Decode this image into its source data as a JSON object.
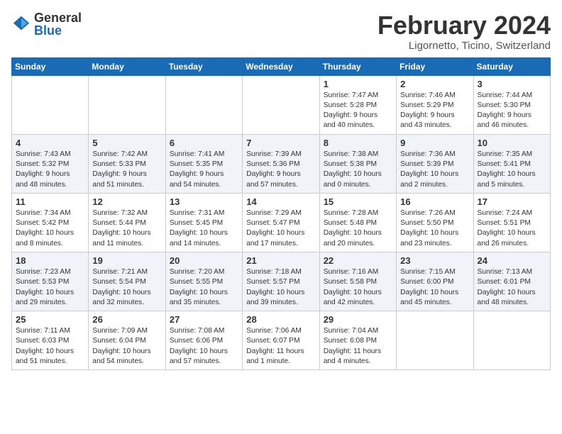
{
  "header": {
    "logo_general": "General",
    "logo_blue": "Blue",
    "month_year": "February 2024",
    "location": "Ligornetto, Ticino, Switzerland"
  },
  "weekdays": [
    "Sunday",
    "Monday",
    "Tuesday",
    "Wednesday",
    "Thursday",
    "Friday",
    "Saturday"
  ],
  "weeks": [
    [
      {
        "day": "",
        "info": ""
      },
      {
        "day": "",
        "info": ""
      },
      {
        "day": "",
        "info": ""
      },
      {
        "day": "",
        "info": ""
      },
      {
        "day": "1",
        "info": "Sunrise: 7:47 AM\nSunset: 5:28 PM\nDaylight: 9 hours\nand 40 minutes."
      },
      {
        "day": "2",
        "info": "Sunrise: 7:46 AM\nSunset: 5:29 PM\nDaylight: 9 hours\nand 43 minutes."
      },
      {
        "day": "3",
        "info": "Sunrise: 7:44 AM\nSunset: 5:30 PM\nDaylight: 9 hours\nand 46 minutes."
      }
    ],
    [
      {
        "day": "4",
        "info": "Sunrise: 7:43 AM\nSunset: 5:32 PM\nDaylight: 9 hours\nand 48 minutes."
      },
      {
        "day": "5",
        "info": "Sunrise: 7:42 AM\nSunset: 5:33 PM\nDaylight: 9 hours\nand 51 minutes."
      },
      {
        "day": "6",
        "info": "Sunrise: 7:41 AM\nSunset: 5:35 PM\nDaylight: 9 hours\nand 54 minutes."
      },
      {
        "day": "7",
        "info": "Sunrise: 7:39 AM\nSunset: 5:36 PM\nDaylight: 9 hours\nand 57 minutes."
      },
      {
        "day": "8",
        "info": "Sunrise: 7:38 AM\nSunset: 5:38 PM\nDaylight: 10 hours\nand 0 minutes."
      },
      {
        "day": "9",
        "info": "Sunrise: 7:36 AM\nSunset: 5:39 PM\nDaylight: 10 hours\nand 2 minutes."
      },
      {
        "day": "10",
        "info": "Sunrise: 7:35 AM\nSunset: 5:41 PM\nDaylight: 10 hours\nand 5 minutes."
      }
    ],
    [
      {
        "day": "11",
        "info": "Sunrise: 7:34 AM\nSunset: 5:42 PM\nDaylight: 10 hours\nand 8 minutes."
      },
      {
        "day": "12",
        "info": "Sunrise: 7:32 AM\nSunset: 5:44 PM\nDaylight: 10 hours\nand 11 minutes."
      },
      {
        "day": "13",
        "info": "Sunrise: 7:31 AM\nSunset: 5:45 PM\nDaylight: 10 hours\nand 14 minutes."
      },
      {
        "day": "14",
        "info": "Sunrise: 7:29 AM\nSunset: 5:47 PM\nDaylight: 10 hours\nand 17 minutes."
      },
      {
        "day": "15",
        "info": "Sunrise: 7:28 AM\nSunset: 5:48 PM\nDaylight: 10 hours\nand 20 minutes."
      },
      {
        "day": "16",
        "info": "Sunrise: 7:26 AM\nSunset: 5:50 PM\nDaylight: 10 hours\nand 23 minutes."
      },
      {
        "day": "17",
        "info": "Sunrise: 7:24 AM\nSunset: 5:51 PM\nDaylight: 10 hours\nand 26 minutes."
      }
    ],
    [
      {
        "day": "18",
        "info": "Sunrise: 7:23 AM\nSunset: 5:53 PM\nDaylight: 10 hours\nand 29 minutes."
      },
      {
        "day": "19",
        "info": "Sunrise: 7:21 AM\nSunset: 5:54 PM\nDaylight: 10 hours\nand 32 minutes."
      },
      {
        "day": "20",
        "info": "Sunrise: 7:20 AM\nSunset: 5:55 PM\nDaylight: 10 hours\nand 35 minutes."
      },
      {
        "day": "21",
        "info": "Sunrise: 7:18 AM\nSunset: 5:57 PM\nDaylight: 10 hours\nand 39 minutes."
      },
      {
        "day": "22",
        "info": "Sunrise: 7:16 AM\nSunset: 5:58 PM\nDaylight: 10 hours\nand 42 minutes."
      },
      {
        "day": "23",
        "info": "Sunrise: 7:15 AM\nSunset: 6:00 PM\nDaylight: 10 hours\nand 45 minutes."
      },
      {
        "day": "24",
        "info": "Sunrise: 7:13 AM\nSunset: 6:01 PM\nDaylight: 10 hours\nand 48 minutes."
      }
    ],
    [
      {
        "day": "25",
        "info": "Sunrise: 7:11 AM\nSunset: 6:03 PM\nDaylight: 10 hours\nand 51 minutes."
      },
      {
        "day": "26",
        "info": "Sunrise: 7:09 AM\nSunset: 6:04 PM\nDaylight: 10 hours\nand 54 minutes."
      },
      {
        "day": "27",
        "info": "Sunrise: 7:08 AM\nSunset: 6:06 PM\nDaylight: 10 hours\nand 57 minutes."
      },
      {
        "day": "28",
        "info": "Sunrise: 7:06 AM\nSunset: 6:07 PM\nDaylight: 11 hours\nand 1 minute."
      },
      {
        "day": "29",
        "info": "Sunrise: 7:04 AM\nSunset: 6:08 PM\nDaylight: 11 hours\nand 4 minutes."
      },
      {
        "day": "",
        "info": ""
      },
      {
        "day": "",
        "info": ""
      }
    ]
  ]
}
